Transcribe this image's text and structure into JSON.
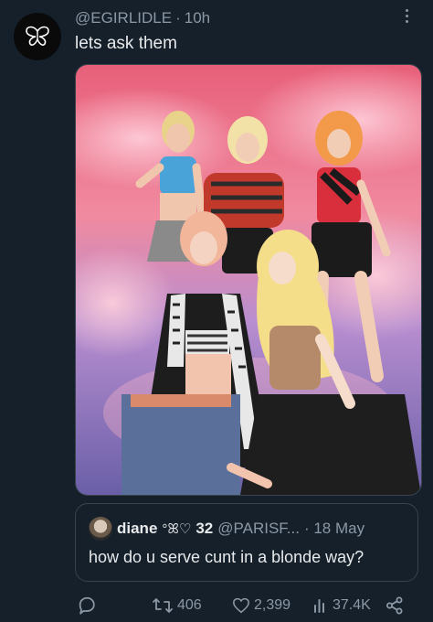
{
  "tweet": {
    "handle": "@EGIRLIDLE",
    "separator": "·",
    "time": "10h",
    "text": "lets ask them",
    "avatar_icon": "butterfly-icon"
  },
  "quote": {
    "name": "diane",
    "emoji": "°ꕤ♡",
    "followers_badge": "32",
    "handle": "@PARISF...",
    "date": "· 18 May",
    "text": "how do u serve cunt in a blonde way?"
  },
  "actions": {
    "reply_icon": "reply-icon",
    "retweets": "406",
    "likes": "2,399",
    "views": "37.4K",
    "share_icon": "share-icon"
  },
  "colors": {
    "background": "#15202b",
    "text": "#e7e9ea",
    "muted": "#8b98a5",
    "border": "#38444d"
  }
}
